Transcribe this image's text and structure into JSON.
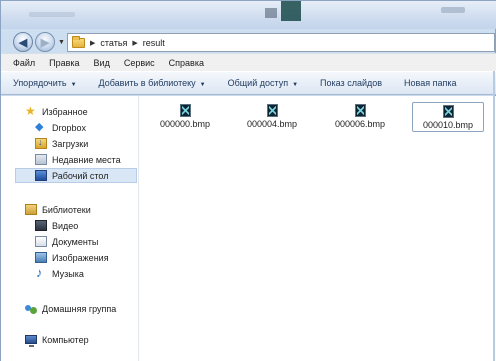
{
  "window": {
    "accent": "#d8e6f5",
    "frame_color": "#b9d1ea"
  },
  "address": {
    "crumbs": [
      "статья",
      "result"
    ]
  },
  "menu": {
    "items": [
      "Файл",
      "Правка",
      "Вид",
      "Сервис",
      "Справка"
    ]
  },
  "toolbar": {
    "organize": "Упорядочить",
    "add_library": "Добавить в библиотеку",
    "share": "Общий доступ",
    "slideshow": "Показ слайдов",
    "new_folder": "Новая папка"
  },
  "nav": {
    "favorites": "Избранное",
    "dropbox": "Dropbox",
    "downloads": "Загрузки",
    "recent": "Недавние места",
    "desktop": "Рабочий стол",
    "libraries": "Библиотеки",
    "video": "Видео",
    "documents": "Документы",
    "images": "Изображения",
    "music": "Музыка",
    "homegroup": "Домашняя группа",
    "computer": "Компьютер"
  },
  "files": [
    {
      "name": "000000.bmp",
      "icon": "bmp-file-icon"
    },
    {
      "name": "000004.bmp",
      "icon": "bmp-file-icon"
    },
    {
      "name": "000006.bmp",
      "icon": "bmp-file-icon"
    },
    {
      "name": "000010.bmp",
      "icon": "bmp-file-icon"
    }
  ]
}
